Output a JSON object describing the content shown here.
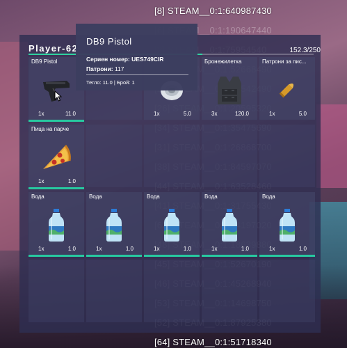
{
  "steam_list": [
    {
      "text": "[8] STEAM__0:1:640987430",
      "dim": false
    },
    {
      "text": "[6] STEAM__0:1:190647440",
      "dim": true
    },
    {
      "text": "[2] STEAM__0:1:75954540",
      "dim": true
    },
    {
      "text": "[28] STEAM__0:1:52668490",
      "dim": true
    },
    {
      "text": "[22] STEAM__0:1:13542490",
      "dim": true
    },
    {
      "text": "[26] STEAM__0:1:20595320",
      "dim": true
    },
    {
      "text": "[34] STEAM__0:1:35475690",
      "dim": true
    },
    {
      "text": "[31] STEAM__0:1:26868700",
      "dim": true
    },
    {
      "text": "[38] STEAM__0:1:84597070",
      "dim": true
    },
    {
      "text": "[44] STEAM__0:1:63528460",
      "dim": true
    },
    {
      "text": "[41] STEAM__0:1:31755430",
      "dim": true
    },
    {
      "text": "[62] STEAM__0:1:84197020",
      "dim": true
    },
    {
      "text": "[48] STEAM__0:1:18639880",
      "dim": true
    },
    {
      "text": "[45] STEAM__0:1:52670190",
      "dim": true
    },
    {
      "text": "[46] STEAM__0:1:45268940",
      "dim": true
    },
    {
      "text": "[53] STEAM__0:1:14698750",
      "dim": true
    },
    {
      "text": "[52] STEAM__0:1:87925380",
      "dim": true
    },
    {
      "text": "[64] STEAM__0:1:51718340",
      "dim": false
    }
  ],
  "inventory": {
    "player_name": "Player-62",
    "weight": "152.3/250",
    "weight_fraction": 0.61,
    "slots": [
      {
        "name": "DB9 Pistol",
        "qty": "1x",
        "weight": "11.0",
        "icon": "pistol-icon",
        "durability": 1.0
      },
      {
        "name": "",
        "qty": "",
        "weight": "",
        "icon": "",
        "durability": 0
      },
      {
        "name": "",
        "qty": "1x",
        "weight": "5.0",
        "icon": "tape-icon",
        "durability": 0
      },
      {
        "name": "Бронежилетка",
        "qty": "3x",
        "weight": "120.0",
        "icon": "vest-icon",
        "durability": 0
      },
      {
        "name": "Патрони за пис...",
        "qty": "1x",
        "weight": "5.0",
        "icon": "bullet-icon",
        "durability": 0
      },
      {
        "name": "Пица на парче",
        "qty": "1x",
        "weight": "1.0",
        "icon": "pizza-icon",
        "durability": 1.0
      },
      {
        "name": "Вода",
        "qty": "1x",
        "weight": "1.0",
        "icon": "water-bottle-icon",
        "durability": 1.0
      },
      {
        "name": "Вода",
        "qty": "1x",
        "weight": "1.0",
        "icon": "water-bottle-icon",
        "durability": 1.0
      },
      {
        "name": "Вода",
        "qty": "1x",
        "weight": "1.0",
        "icon": "water-bottle-icon",
        "durability": 1.0
      },
      {
        "name": "Вода",
        "qty": "1x",
        "weight": "1.0",
        "icon": "water-bottle-icon",
        "durability": 1.0
      },
      {
        "name": "Вода",
        "qty": "1x",
        "weight": "1.0",
        "icon": "water-bottle-icon",
        "durability": 1.0
      }
    ]
  },
  "tooltip": {
    "title": "DB9 Pistol",
    "serial_label": "Сериен номер:",
    "serial_value": "UES749CIR",
    "ammo_label": "Патрони:",
    "ammo_value": "117",
    "footer": "Тегло: 11.0 | Брой: 1"
  },
  "colors": {
    "panel_bg": "#2e2e52",
    "accent": "#27c9a0",
    "text": "#ffffff"
  }
}
